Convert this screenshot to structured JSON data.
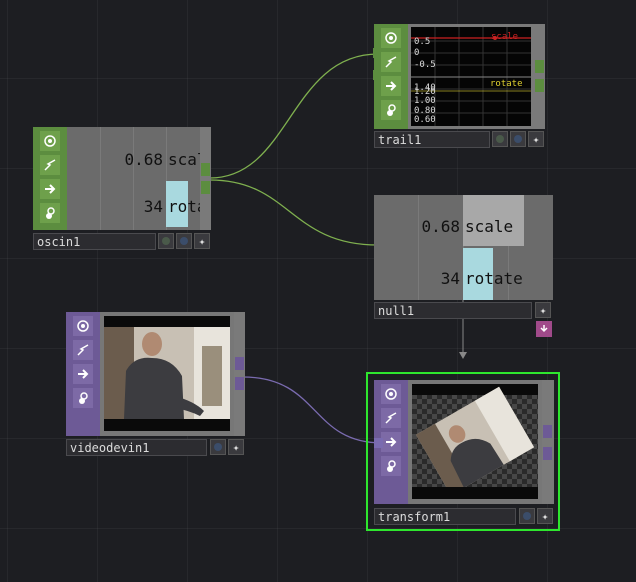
{
  "network": {
    "nodes": {
      "oscin": {
        "name": "oscin1",
        "channels": [
          {
            "name": "scale",
            "value": "0.68",
            "level": 0.68
          },
          {
            "name": "rotate",
            "value": "34",
            "level": 0.34
          }
        ]
      },
      "trail": {
        "name": "trail1",
        "graphs": [
          {
            "label": "scale",
            "ticks": [
              "0.5",
              "0",
              "-0.5"
            ]
          },
          {
            "label": "rotate",
            "ticks": [
              "1.40",
              "1.20",
              "1.00",
              "0.80",
              "0.60"
            ]
          }
        ]
      },
      "null": {
        "name": "null1",
        "channels": [
          {
            "name": "scale",
            "value": "0.68",
            "level": 0.68
          },
          {
            "name": "rotate",
            "value": "34",
            "level": 0.34
          }
        ]
      },
      "videodevin": {
        "name": "videodevin1"
      },
      "transform": {
        "name": "transform1",
        "selected": true
      }
    },
    "icons": [
      "viewer-icon",
      "cook-icon",
      "bypass-arrow-icon",
      "lock-icon"
    ],
    "colors": {
      "chop_family": "#5c8d3f",
      "top_family": "#6d5a96",
      "selected_outline": "#2ee62e",
      "chop_wire": "#7fb04f",
      "top_wire": "#7a6bb0",
      "channel_bar": "#a9d9df",
      "trail_scale": "#cc2222",
      "trail_rotate": "#e0d030"
    }
  }
}
